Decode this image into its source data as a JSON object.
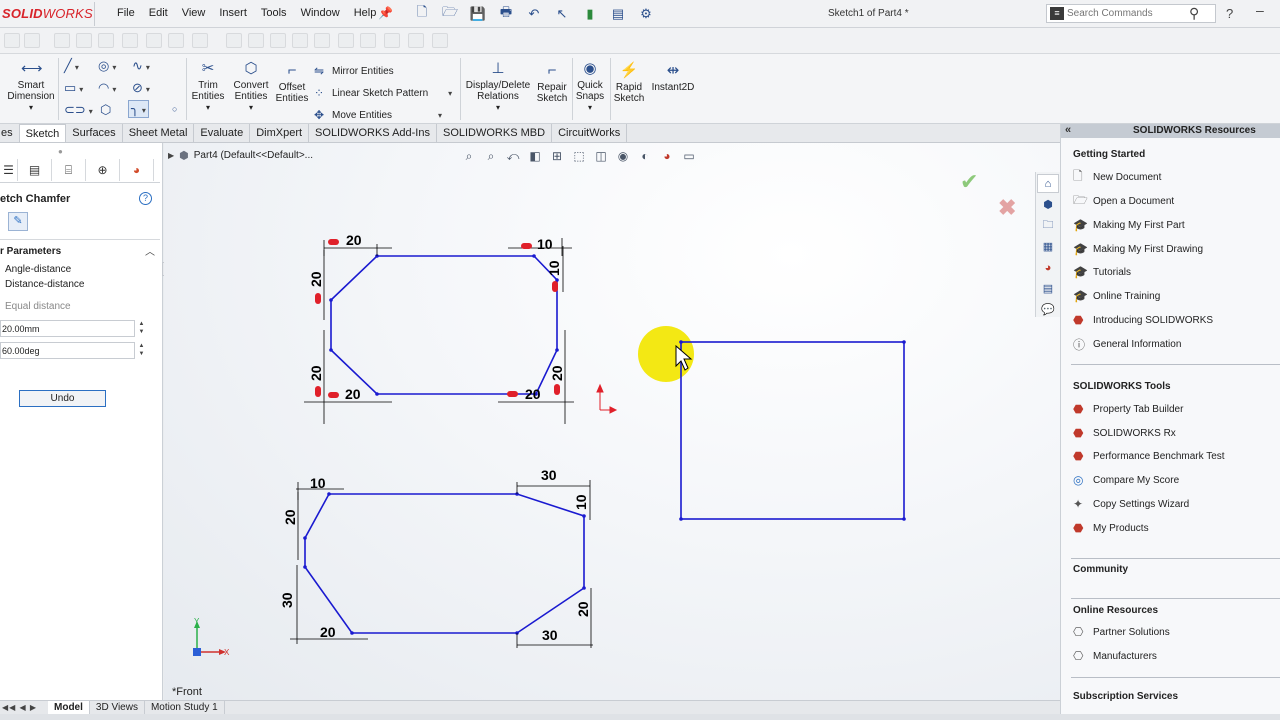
{
  "app": {
    "logo_solid": "SOLID",
    "logo_works": "WORKS",
    "menu": [
      "File",
      "Edit",
      "View",
      "Insert",
      "Tools",
      "Window",
      "Help"
    ],
    "doc_title": "Sketch1 of Part4 *",
    "search_placeholder": "Search Commands",
    "help_label": "?"
  },
  "commands": {
    "smart_dimension": "Smart\nDimension",
    "trim_entities": "Trim\nEntities",
    "convert_entities": "Convert\nEntities",
    "offset_entities": "Offset\nEntities",
    "mirror_entities": "Mirror Entities",
    "linear_sketch_pattern": "Linear Sketch Pattern",
    "move_entities": "Move Entities",
    "display_delete_relations": "Display/Delete\nRelations",
    "repair_sketch": "Repair\nSketch",
    "quick_snaps": "Quick\nSnaps",
    "rapid_sketch": "Rapid\nSketch",
    "instant2d": "Instant2D"
  },
  "tabs": [
    "es",
    "Sketch",
    "Surfaces",
    "Sheet Metal",
    "Evaluate",
    "DimXpert",
    "SOLIDWORKS Add-Ins",
    "SOLIDWORKS MBD",
    "CircuitWorks"
  ],
  "active_tab_index": 1,
  "property_manager": {
    "title": "etch Chamfer",
    "help": "?",
    "section": "r Parameters",
    "option_angle": "Angle-distance",
    "option_distance": "Distance-distance",
    "equal_distance": "Equal distance",
    "distance_value": "20.00mm",
    "angle_value": "60.00deg",
    "undo": "Undo"
  },
  "viewport": {
    "tree_label": "Part4  (Default<<Default>...",
    "view_label": "*Front",
    "axis_x": "X",
    "axis_y": "Y"
  },
  "dimensions": {
    "s1_top_left": "20",
    "s1_top_right": "10",
    "s1_left_top": "20",
    "s1_right_top": "10",
    "s1_left_bottom": "20",
    "s1_bottom_left": "20",
    "s1_bottom_right": "20",
    "s1_right_bottom": "20",
    "s2_top_left": "10",
    "s2_top_right": "30",
    "s2_left_top": "20",
    "s2_right_top": "10",
    "s2_left_bottom": "30",
    "s2_bottom_left": "20",
    "s2_bottom_right": "30",
    "s2_right_bottom": "20"
  },
  "resources": {
    "header": "SOLIDWORKS Resources",
    "getting_started": "Getting Started",
    "getting_started_items": [
      "New Document",
      "Open a Document",
      "Making My First Part",
      "Making My First Drawing",
      "Tutorials",
      "Online Training",
      "Introducing SOLIDWORKS",
      "General Information"
    ],
    "tools_title": "SOLIDWORKS Tools",
    "tools_items": [
      "Property Tab Builder",
      "SOLIDWORKS Rx",
      "Performance Benchmark Test",
      "Compare My Score",
      "Copy Settings Wizard",
      "My Products"
    ],
    "community": "Community",
    "online_resources": "Online Resources",
    "online_items": [
      "Partner Solutions",
      "Manufacturers"
    ],
    "subscription": "Subscription Services"
  },
  "bottom_tabs": [
    "Model",
    "3D Views",
    "Motion Study 1"
  ],
  "colors": {
    "sketch_line": "#1a1ad0",
    "dimension": "#000000",
    "relation": "#e0202a",
    "brand_red": "#d8232a",
    "accent_blue": "#2b6fc2",
    "cursor_highlight": "#f2e600"
  }
}
